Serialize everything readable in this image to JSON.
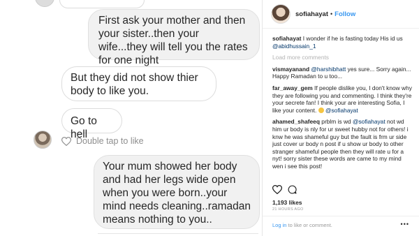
{
  "chat": {
    "messages": [
      {
        "side": "out",
        "text": "First ask your mother and then your sister..then your wife...they will tell you the rates for one night"
      },
      {
        "side": "in",
        "text": "But they did not show thier body to like you."
      },
      {
        "side": "in",
        "text": "Go to hell"
      },
      {
        "side": "out",
        "text": "Your mum showed her body and had her legs wide open when you were born..your mind needs cleaning..ramadan means nothing to you.."
      }
    ],
    "double_tap_label": "Double tap to like"
  },
  "post": {
    "username": "sofiahayat",
    "separator": "•",
    "follow_label": "Follow",
    "caption_user": "sofiahayat",
    "caption_text": " I wonder if he is fasting today His id us ",
    "caption_mention": "@abidhussain_1",
    "load_more": "Load more comments",
    "comments": [
      {
        "user": "vismayanand",
        "mention": "@harshibhatt",
        "text": " yes sure... Sorry again... Happy Ramadan to u too..."
      },
      {
        "user": "far_away_gem",
        "text": " If people dislike you, I don't know why they are following you and commenting. I think they're your secrete fan! I think your are interesting Sofia, I like your content. ",
        "mention_end": "@sofiahayat"
      },
      {
        "user": "ahamed_shafeeq",
        "text": " prblm is wd ",
        "mention": "@sofiahayat",
        "text2": " not wd him ur body is nly for ur sweet hubby not for others! i knw he was shameful guy but the fault is frm ur side just cover ur body n post if u show ur body to other stranger shameful people then they will rate u for a nyt! sorry sister these words are came to my mind wen i see this post!"
      }
    ],
    "likes": "1,193 likes",
    "time": "21 HOURS AGO",
    "login_link": "Log in",
    "login_text": " to like or comment.",
    "more_label": "•••"
  },
  "icons": {
    "heart": "heart-icon",
    "comment": "comment-icon"
  }
}
